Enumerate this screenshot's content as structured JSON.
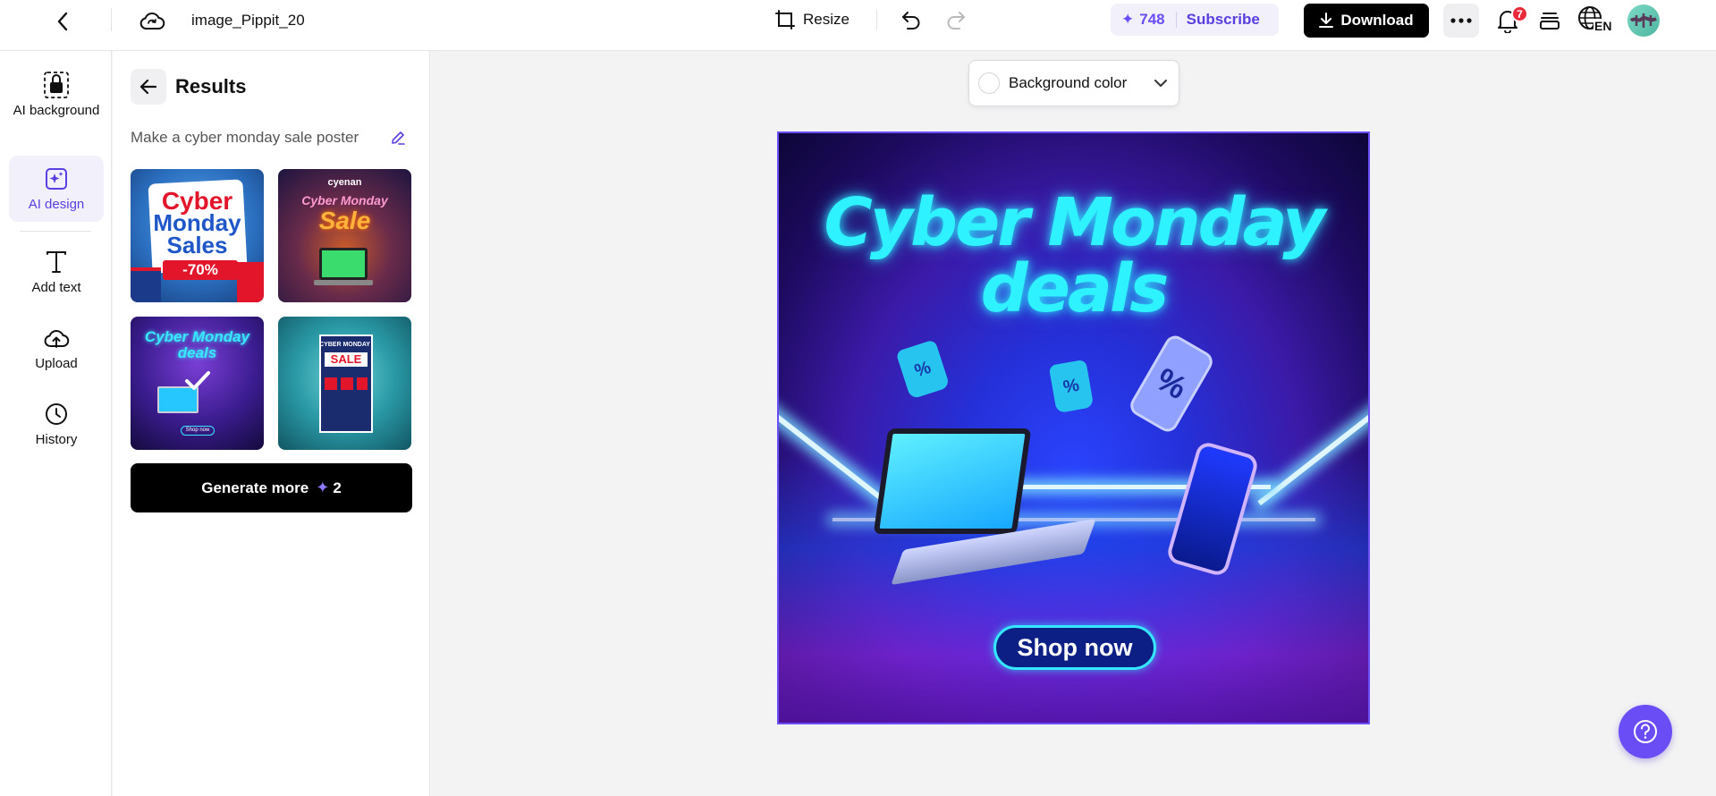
{
  "topbar": {
    "filename": "image_Pippit_20",
    "resize_label": "Resize",
    "credits": "748",
    "subscribe_label": "Subscribe",
    "download_label": "Download",
    "notifications_count": "7",
    "language": "EN"
  },
  "rail": {
    "items": [
      {
        "label": "AI background",
        "icon": "ai-background-icon"
      },
      {
        "label": "AI design",
        "icon": "ai-design-icon"
      },
      {
        "label": "Add text",
        "icon": "text-icon"
      },
      {
        "label": "Upload",
        "icon": "upload-cloud-icon"
      },
      {
        "label": "History",
        "icon": "clock-icon"
      }
    ],
    "active": "AI design"
  },
  "panel": {
    "title": "Results",
    "prompt": "Make a cyber monday sale poster",
    "thumbnails": [
      {
        "line1": "Cyber",
        "line2": "Monday",
        "line3": "Sales",
        "badge": "-70%"
      },
      {
        "brand": "cyenan",
        "line1": "Cyber Monday",
        "line2": "Sale"
      },
      {
        "line1": "Cyber Monday",
        "line2": "deals",
        "selected": true,
        "button": "Shop now"
      },
      {
        "line1": "CYBER MONDAY",
        "line2": "SALE"
      }
    ],
    "generate_label": "Generate more",
    "generate_cost": "2"
  },
  "canvas": {
    "bg_color_label": "Background color",
    "poster": {
      "title_line1": "Cyber Monday",
      "title_line2": "deals",
      "button": "Shop now"
    }
  },
  "colors": {
    "accent": "#6b4df5",
    "neon": "#2ef2ff",
    "badge_red": "#ea2a3b"
  }
}
